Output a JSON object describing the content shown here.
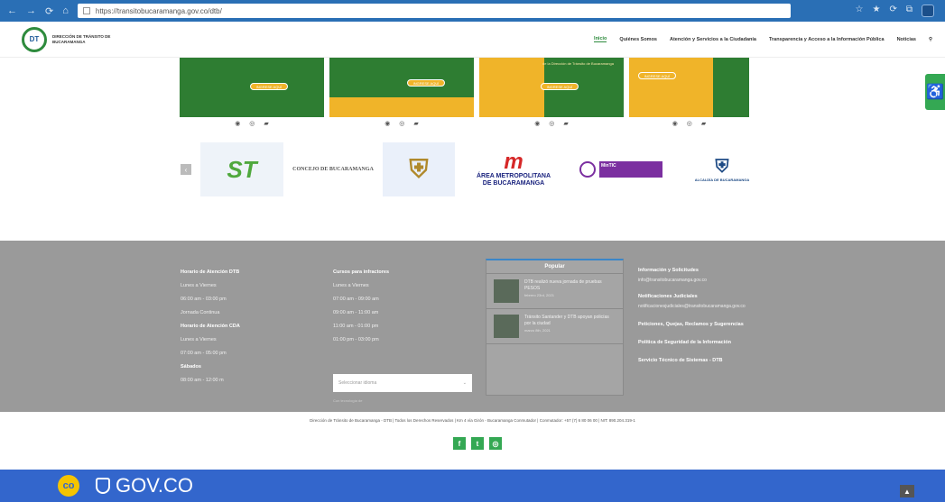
{
  "browser": {
    "url": "https://transitobucaramanga.gov.co/dtb/",
    "nav": [
      "←",
      "→",
      "⟳",
      "⌂"
    ],
    "tools": [
      "☆",
      "★",
      "⟳",
      "⧉"
    ]
  },
  "header": {
    "logo_mark": "DT",
    "logo_text": "DIRECCIÓN DE TRÁNSITO DE BUCARAMANGA",
    "menu": [
      "Inicio",
      "Quiénes Somos",
      "Atención y Servicios a la Ciudadanía",
      "Transparencia y Acceso a la Información Pública",
      "Noticias"
    ],
    "search_icon": "⚲"
  },
  "accessibility_icon": "♿",
  "cards": [
    {
      "cta": "INGRESE AQUÍ",
      "text": ""
    },
    {
      "cta": "INGRESE AQUÍ",
      "text": ""
    },
    {
      "cta": "INGRESE AQUÍ",
      "text": "de la Dirección de Tránsito de Bucaramanga"
    },
    {
      "cta": "INGRESE AQUÍ",
      "text": ""
    }
  ],
  "card_strip_icons": [
    "◉",
    "◎",
    "▰"
  ],
  "logos": {
    "prev_arrow": "‹",
    "st": "ST",
    "concejo": "CONCEJO DE BUCARAMANGA",
    "shield": "⛨",
    "amb_mark": "m",
    "amb_line1": "ÁREA METROPOLITANA",
    "amb_line2": "DE BUCARAMANGA",
    "mintic": "MinTIC",
    "alcaldia": "ALCALDÍA DE BUCARAMANGA"
  },
  "footer": {
    "col1": [
      {
        "text": "Horario de Atención DTB",
        "bold": true
      },
      {
        "text": "Lunes a Viernes",
        "bold": false
      },
      {
        "text": "06:00 am - 03:00 pm",
        "bold": false
      },
      {
        "text": "Jornada Continua",
        "bold": false
      },
      {
        "text": "Horario de Atención CDA",
        "bold": true
      },
      {
        "text": "Lunes a Viernes",
        "bold": false
      },
      {
        "text": "07:00 am - 05:00 pm",
        "bold": false
      },
      {
        "text": "Sábados",
        "bold": true
      },
      {
        "text": "08:00 am - 12:00 m",
        "bold": false
      }
    ],
    "col2": [
      {
        "text": "Cursos para infractores",
        "bold": true
      },
      {
        "text": "Lunes a Viernes",
        "bold": false
      },
      {
        "text": "07:00 am - 09:00 am",
        "bold": false
      },
      {
        "text": "09:00 am - 11:00 am",
        "bold": false
      },
      {
        "text": "11:00 am - 01:00 pm",
        "bold": false
      },
      {
        "text": "01:00 pm - 03:00 pm",
        "bold": false
      }
    ],
    "select_placeholder": "Seleccionar idioma",
    "select_note": "Con tecnología de",
    "popular_title": "Popular",
    "posts": [
      {
        "title": "DTB realizó nueva jornada de pruebas PESOS",
        "date": "febrero 23rd, 2021"
      },
      {
        "title": "Tránsito Santander y DTB apoyan policías por la ciudad",
        "date": "marzo 8th, 2021"
      }
    ],
    "right": [
      {
        "title": "Información y Solicitudes",
        "sub": "info@transitobucaramanga.gov.co"
      },
      {
        "title": "Notificaciones Judiciales",
        "sub": "notificacionesjudiciales@transitobucaramanga.gov.co"
      },
      {
        "title": "Peticiones, Quejas, Reclamos y Sugerencias",
        "sub": ""
      },
      {
        "title": "Política de Seguridad de la Información",
        "sub": ""
      },
      {
        "title": "Servicio Técnico de Sistemas - DTB",
        "sub": ""
      }
    ]
  },
  "copyright": "Dirección de Tránsito de Bucaramanga - DTB  |  Todos los Derechos Reservados  |  Km 4 vía Girón - Bucaramanga Conmutador  |  Conmutador: +57 (7) 6 80 06 00  |  NIT: 890.204.319-1",
  "social": [
    "f",
    "t",
    "◎"
  ],
  "gov": {
    "co": "co",
    "label": "GOV.CO"
  },
  "to_top": "▲"
}
